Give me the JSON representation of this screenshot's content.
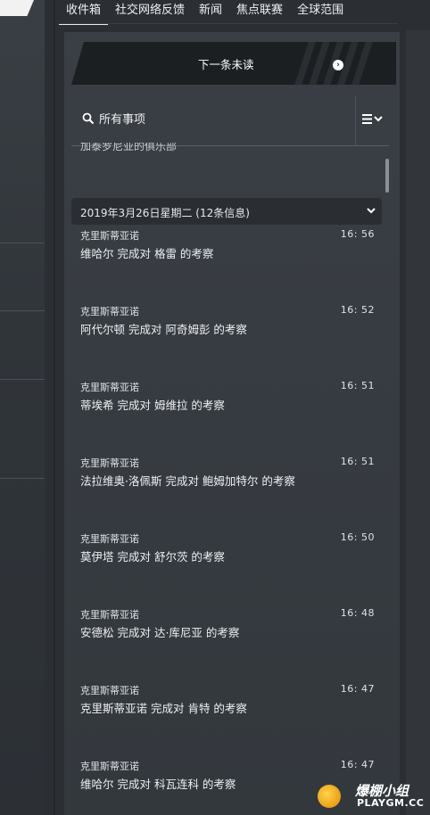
{
  "tabs": [
    {
      "label": "收件箱"
    },
    {
      "label": "社交网络反馈"
    },
    {
      "label": "新闻"
    },
    {
      "label": "焦点联赛"
    },
    {
      "label": "全球范围"
    }
  ],
  "next_unread": {
    "label": "下一条未读"
  },
  "filter": {
    "label": "所有事项"
  },
  "partial_text": "加泰罗尼亚的俱乐部",
  "date_group": {
    "label": "2019年3月26日星期二 (12条信息)"
  },
  "messages": [
    {
      "sender": "克里斯蒂亚诺",
      "time": "16: 56",
      "body": "维哈尔 完成对 格雷 的考察"
    },
    {
      "sender": "克里斯蒂亚诺",
      "time": "16: 52",
      "body": "阿代尔顿 完成对 阿奇姆彭 的考察"
    },
    {
      "sender": "克里斯蒂亚诺",
      "time": "16: 51",
      "body": "蒂埃希 完成对 姆维拉 的考察"
    },
    {
      "sender": "克里斯蒂亚诺",
      "time": "16: 51",
      "body": "法拉维奥·洛佩斯 完成对 鲍姆加特尔 的考察"
    },
    {
      "sender": "克里斯蒂亚诺",
      "time": "16: 50",
      "body": "莫伊塔 完成对 舒尔茨 的考察"
    },
    {
      "sender": "克里斯蒂亚诺",
      "time": "16: 48",
      "body": "安德松 完成对 达·库尼亚 的考察"
    },
    {
      "sender": "克里斯蒂亚诺",
      "time": "16: 47",
      "body": "克里斯蒂亚诺 完成对 肯特 的考察"
    },
    {
      "sender": "克里斯蒂亚诺",
      "time": "16: 47",
      "body": "维哈尔 完成对 科瓦连科 的考察"
    }
  ],
  "watermark": {
    "line1": "爆棚小组",
    "line2": "PLAYGM.CC"
  }
}
